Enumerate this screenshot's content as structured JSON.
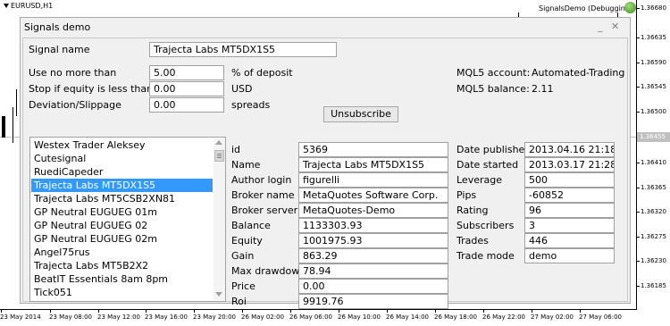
{
  "chart": {
    "symbol": "EURUSD,H1",
    "ea_label": "SignalsDemo (Debugging)",
    "current_price": "1.36455",
    "prices": [
      "1.36680",
      "1.36635",
      "1.36590",
      "1.36545",
      "1.36500",
      "1.36455",
      "1.36410",
      "1.36365",
      "1.36320",
      "1.36275",
      "1.36230",
      "1.36185"
    ],
    "times": [
      "23 May 2014",
      "23 May 08:00",
      "23 May 12:00",
      "23 May 16:00",
      "23 May 20:00",
      "26 May 02:00",
      "26 May 06:00",
      "26 May 10:00",
      "26 May 14:00",
      "26 May 18:00",
      "26 May 22:00",
      "27 May 02:00",
      "27 May 06:00"
    ]
  },
  "dialog": {
    "title": "Signals demo",
    "minimize": "_",
    "close": "✕",
    "signal_name_label": "Signal name",
    "signal_name_value": "Trajecta Labs MT5DX1S5",
    "use_no_more_label": "Use no more than",
    "use_no_more_value": "5.00",
    "use_no_more_unit": "% of deposit",
    "stop_if_equity_label": "Stop if equity is less than",
    "stop_if_equity_value": "0.00",
    "stop_if_equity_unit": "USD",
    "deviation_label": "Deviation/Slippage",
    "deviation_value": "0.00",
    "deviation_unit": "spreads",
    "mql5_account_label": "MQL5 account:",
    "mql5_account_value": "Automated-Trading",
    "mql5_balance_label": "MQL5 balance:",
    "mql5_balance_value": "2.11",
    "unsubscribe_label": "Unsubscribe",
    "signals": [
      "Westex Trader Aleksey",
      "Cutesignal",
      "RuediCapeder",
      "Trajecta Labs MT5DX1S5",
      "Trajecta Labs MT5CSB2XN81",
      "GP Neutral EUGUEG 01m",
      "GP Neutral EUGUEG 02",
      "GP Neutral EUGUEG 02m",
      "Angel75rus",
      "Trajecta Labs MT5B2X2",
      "BeatIT Essentials 8am 8pm",
      "Tick051"
    ],
    "selected_signal_index": 3,
    "details_left": [
      {
        "label": "id",
        "value": "5369"
      },
      {
        "label": "Name",
        "value": "Trajecta Labs MT5DX1S5"
      },
      {
        "label": "Author login",
        "value": "figurelli"
      },
      {
        "label": "Broker name",
        "value": "MetaQuotes Software Corp."
      },
      {
        "label": "Broker server",
        "value": "MetaQuotes-Demo"
      },
      {
        "label": "Balance",
        "value": "1133303.93"
      },
      {
        "label": "Equity",
        "value": "1001975.93"
      },
      {
        "label": "Gain",
        "value": "863.29"
      },
      {
        "label": "Max drawdown",
        "value": "78.94"
      },
      {
        "label": "Price",
        "value": "0.00"
      },
      {
        "label": "Roi",
        "value": "9919.76"
      }
    ],
    "details_right": [
      {
        "label": "Date published",
        "value": "2013.04.16 21:18"
      },
      {
        "label": "Date started",
        "value": "2013.03.17 21:28"
      },
      {
        "label": "Leverage",
        "value": "500"
      },
      {
        "label": "Pips",
        "value": "-60852"
      },
      {
        "label": "Rating",
        "value": "96"
      },
      {
        "label": "Subscribers",
        "value": "3"
      },
      {
        "label": "Trades",
        "value": "446"
      },
      {
        "label": "Trade mode",
        "value": "demo"
      }
    ]
  }
}
